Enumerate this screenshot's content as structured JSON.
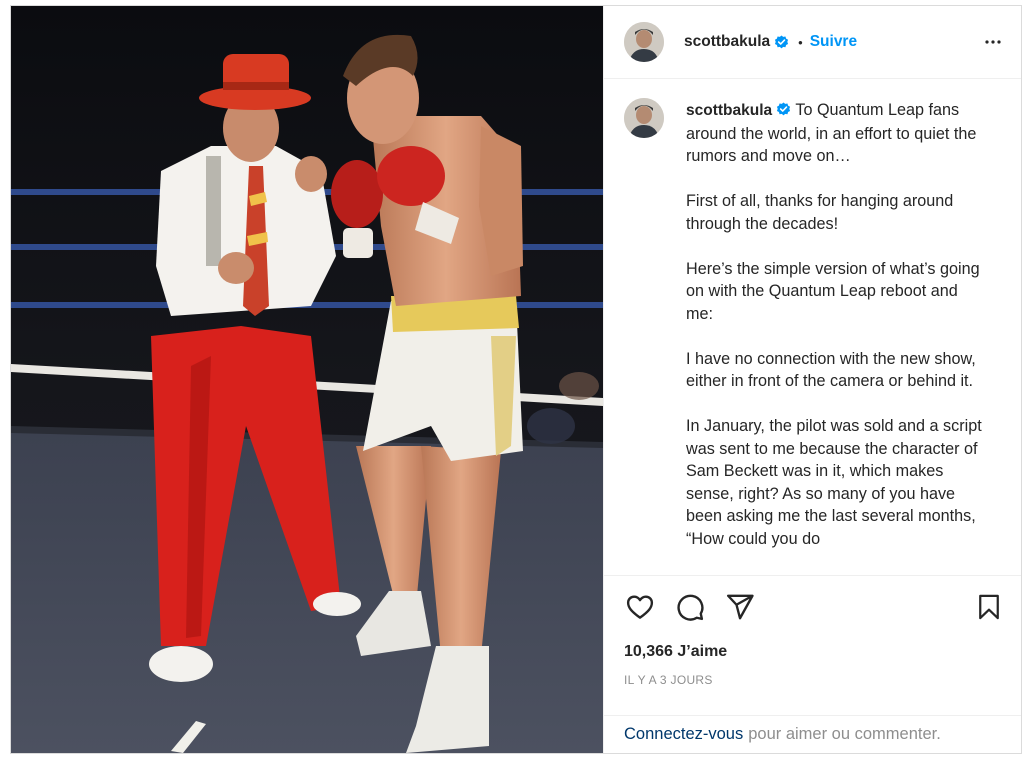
{
  "post": {
    "author": "scottbakula",
    "follow_label": "Suivre",
    "separator": "•",
    "caption_paragraphs": [
      "To Quantum Leap fans around the world, in an effort to quiet the rumors and move on…",
      "First of all, thanks for hanging around through the decades!",
      "Here’s the simple version of what’s going on with the Quantum Leap reboot and me:",
      "I have no connection with the new show, either in front of the camera or behind it.",
      "In January, the pilot was sold and a script was sent to me because the character of Sam Beckett was in it, which makes sense, right? As so many of you have been asking me the last several months, “How could you do"
    ],
    "likes_text": "10,366 J’aime",
    "time_text": "IL Y A 3 JOURS"
  },
  "footer": {
    "login_link": "Connectez-vous",
    "login_rest": "pour aimer ou commenter."
  },
  "icons": {
    "verified": "verified-badge-icon",
    "more": "more-options-icon",
    "like": "heart-icon",
    "comment": "comment-icon",
    "share": "paper-plane-icon",
    "save": "bookmark-icon"
  },
  "colors": {
    "accent_blue": "#0095f6",
    "link_dark_blue": "#00376b",
    "muted_text": "#8e8e8e"
  }
}
